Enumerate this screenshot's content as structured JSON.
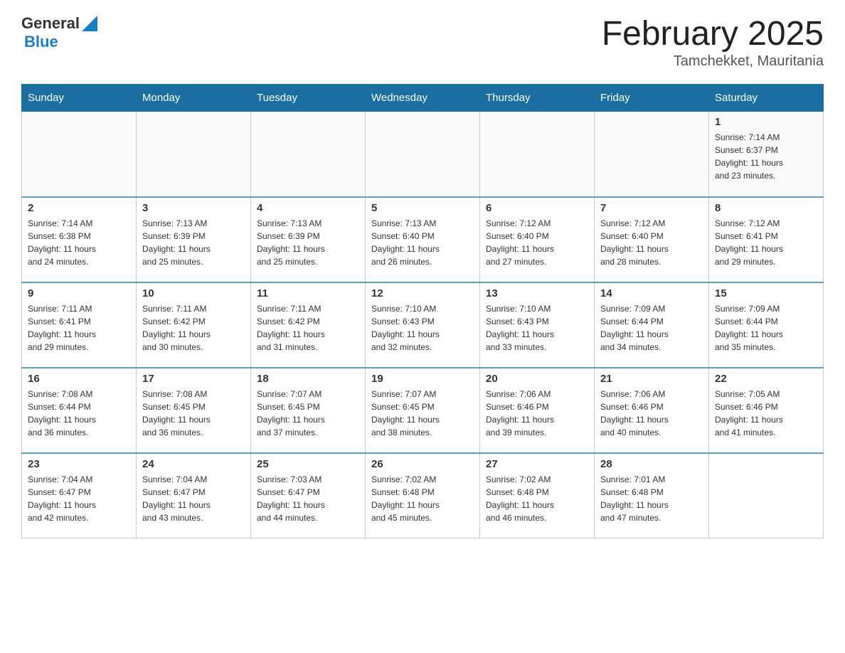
{
  "header": {
    "logo_general": "General",
    "logo_blue": "Blue",
    "month_title": "February 2025",
    "location": "Tamchekket, Mauritania"
  },
  "days_of_week": [
    "Sunday",
    "Monday",
    "Tuesday",
    "Wednesday",
    "Thursday",
    "Friday",
    "Saturday"
  ],
  "weeks": [
    {
      "days": [
        {
          "number": "",
          "info": ""
        },
        {
          "number": "",
          "info": ""
        },
        {
          "number": "",
          "info": ""
        },
        {
          "number": "",
          "info": ""
        },
        {
          "number": "",
          "info": ""
        },
        {
          "number": "",
          "info": ""
        },
        {
          "number": "1",
          "info": "Sunrise: 7:14 AM\nSunset: 6:37 PM\nDaylight: 11 hours\nand 23 minutes."
        }
      ]
    },
    {
      "days": [
        {
          "number": "2",
          "info": "Sunrise: 7:14 AM\nSunset: 6:38 PM\nDaylight: 11 hours\nand 24 minutes."
        },
        {
          "number": "3",
          "info": "Sunrise: 7:13 AM\nSunset: 6:39 PM\nDaylight: 11 hours\nand 25 minutes."
        },
        {
          "number": "4",
          "info": "Sunrise: 7:13 AM\nSunset: 6:39 PM\nDaylight: 11 hours\nand 25 minutes."
        },
        {
          "number": "5",
          "info": "Sunrise: 7:13 AM\nSunset: 6:40 PM\nDaylight: 11 hours\nand 26 minutes."
        },
        {
          "number": "6",
          "info": "Sunrise: 7:12 AM\nSunset: 6:40 PM\nDaylight: 11 hours\nand 27 minutes."
        },
        {
          "number": "7",
          "info": "Sunrise: 7:12 AM\nSunset: 6:40 PM\nDaylight: 11 hours\nand 28 minutes."
        },
        {
          "number": "8",
          "info": "Sunrise: 7:12 AM\nSunset: 6:41 PM\nDaylight: 11 hours\nand 29 minutes."
        }
      ]
    },
    {
      "days": [
        {
          "number": "9",
          "info": "Sunrise: 7:11 AM\nSunset: 6:41 PM\nDaylight: 11 hours\nand 29 minutes."
        },
        {
          "number": "10",
          "info": "Sunrise: 7:11 AM\nSunset: 6:42 PM\nDaylight: 11 hours\nand 30 minutes."
        },
        {
          "number": "11",
          "info": "Sunrise: 7:11 AM\nSunset: 6:42 PM\nDaylight: 11 hours\nand 31 minutes."
        },
        {
          "number": "12",
          "info": "Sunrise: 7:10 AM\nSunset: 6:43 PM\nDaylight: 11 hours\nand 32 minutes."
        },
        {
          "number": "13",
          "info": "Sunrise: 7:10 AM\nSunset: 6:43 PM\nDaylight: 11 hours\nand 33 minutes."
        },
        {
          "number": "14",
          "info": "Sunrise: 7:09 AM\nSunset: 6:44 PM\nDaylight: 11 hours\nand 34 minutes."
        },
        {
          "number": "15",
          "info": "Sunrise: 7:09 AM\nSunset: 6:44 PM\nDaylight: 11 hours\nand 35 minutes."
        }
      ]
    },
    {
      "days": [
        {
          "number": "16",
          "info": "Sunrise: 7:08 AM\nSunset: 6:44 PM\nDaylight: 11 hours\nand 36 minutes."
        },
        {
          "number": "17",
          "info": "Sunrise: 7:08 AM\nSunset: 6:45 PM\nDaylight: 11 hours\nand 36 minutes."
        },
        {
          "number": "18",
          "info": "Sunrise: 7:07 AM\nSunset: 6:45 PM\nDaylight: 11 hours\nand 37 minutes."
        },
        {
          "number": "19",
          "info": "Sunrise: 7:07 AM\nSunset: 6:45 PM\nDaylight: 11 hours\nand 38 minutes."
        },
        {
          "number": "20",
          "info": "Sunrise: 7:06 AM\nSunset: 6:46 PM\nDaylight: 11 hours\nand 39 minutes."
        },
        {
          "number": "21",
          "info": "Sunrise: 7:06 AM\nSunset: 6:46 PM\nDaylight: 11 hours\nand 40 minutes."
        },
        {
          "number": "22",
          "info": "Sunrise: 7:05 AM\nSunset: 6:46 PM\nDaylight: 11 hours\nand 41 minutes."
        }
      ]
    },
    {
      "days": [
        {
          "number": "23",
          "info": "Sunrise: 7:04 AM\nSunset: 6:47 PM\nDaylight: 11 hours\nand 42 minutes."
        },
        {
          "number": "24",
          "info": "Sunrise: 7:04 AM\nSunset: 6:47 PM\nDaylight: 11 hours\nand 43 minutes."
        },
        {
          "number": "25",
          "info": "Sunrise: 7:03 AM\nSunset: 6:47 PM\nDaylight: 11 hours\nand 44 minutes."
        },
        {
          "number": "26",
          "info": "Sunrise: 7:02 AM\nSunset: 6:48 PM\nDaylight: 11 hours\nand 45 minutes."
        },
        {
          "number": "27",
          "info": "Sunrise: 7:02 AM\nSunset: 6:48 PM\nDaylight: 11 hours\nand 46 minutes."
        },
        {
          "number": "28",
          "info": "Sunrise: 7:01 AM\nSunset: 6:48 PM\nDaylight: 11 hours\nand 47 minutes."
        },
        {
          "number": "",
          "info": ""
        }
      ]
    }
  ]
}
